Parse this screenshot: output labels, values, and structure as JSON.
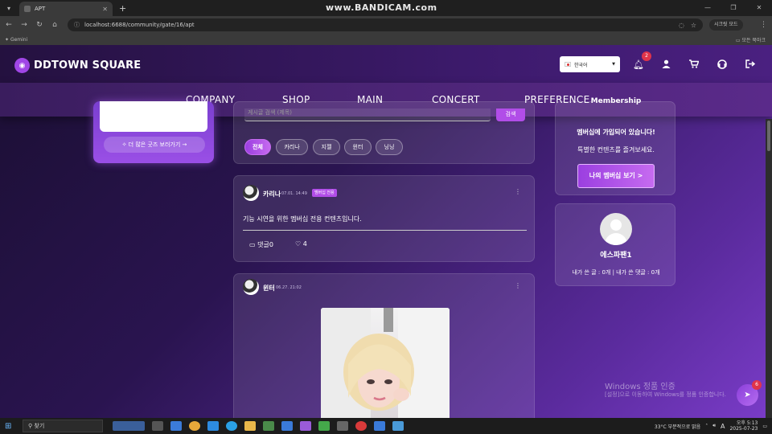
{
  "browser": {
    "tab_title": "APT",
    "new_tab": "+",
    "url": "localhost:6688/community/gate/16/apt",
    "translate_label": "시크릿 모드",
    "bookmark_gemini": "Gemini",
    "bookmark_all": "모든 북마크",
    "recorder_watermark": "www.BANDICAM.com"
  },
  "header": {
    "logo": "DDTOWN SQUARE",
    "language": "한국어",
    "notification_count": "2"
  },
  "nav": [
    "COMPANY",
    "SHOP",
    "MAIN",
    "CONCERT",
    "PREFERENCE"
  ],
  "left": {
    "more_goods": "✧ 더 많은 굿즈 보러가기 →"
  },
  "search": {
    "placeholder": "게시글 검색 (제목)",
    "button": "검색"
  },
  "filters": [
    "전체",
    "카리나",
    "지젤",
    "윈터",
    "닝닝"
  ],
  "posts": [
    {
      "author": "카리나",
      "time": "07.01. 14:49",
      "badge": "멤버십 전용",
      "body": "기능 시연을 위한 멤버십 전용 컨텐츠입니다.",
      "comments": "댓글0",
      "likes": "4"
    },
    {
      "author": "윈터",
      "time": "06.27. 21:02"
    }
  ],
  "membership": {
    "title": "Membership",
    "line1": "멤버십에 가입되어 있습니다!",
    "line2": "특별한 컨텐츠를 즐겨보세요.",
    "button": "나의 멤버십 보기 >"
  },
  "profile": {
    "name": "에스파팬1",
    "stats": "내가 쓴 글 : 0개 | 내가 쓴 댓글 : 0개"
  },
  "windows_activation": {
    "title": "Windows 정품 인증",
    "subtitle": "[설정]으로 이동하여 Windows를 정품 인증합니다."
  },
  "fab_badge": "6",
  "taskbar": {
    "search": "찾기",
    "weather": "33°C  부분적으로 맑음",
    "ime": "A",
    "time": "오후 5:13",
    "date": "2025-07-23"
  },
  "colors": {
    "accent": "#b14de8",
    "header_bg": "#3c1a6b",
    "badge_red": "#e0344a"
  }
}
